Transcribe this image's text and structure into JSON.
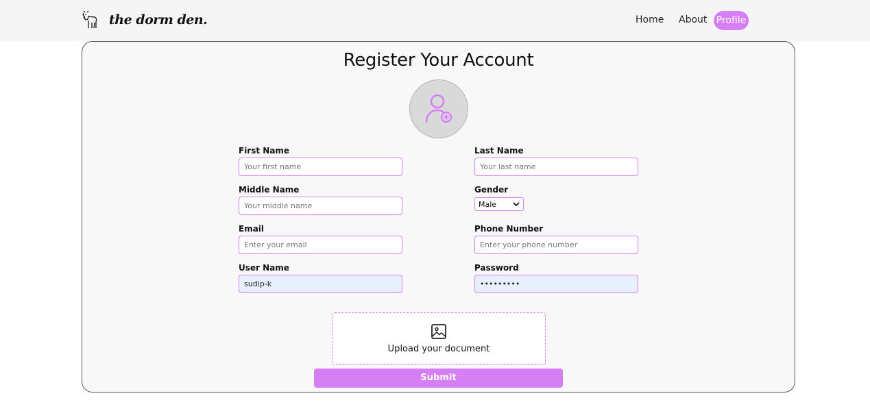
{
  "header": {
    "brand": "the dorm den.",
    "nav": {
      "home": "Home",
      "about": "About",
      "profile": "Profile"
    }
  },
  "form": {
    "title": "Register Your Account",
    "fields": {
      "first_name": {
        "label": "First Name",
        "placeholder": "Your first name",
        "value": ""
      },
      "last_name": {
        "label": "Last Name",
        "placeholder": "Your last name",
        "value": ""
      },
      "middle_name": {
        "label": "Middle Name",
        "placeholder": "Your middle name",
        "value": ""
      },
      "gender": {
        "label": "Gender",
        "selected": "Male"
      },
      "email": {
        "label": "Email",
        "placeholder": "Enter your email",
        "value": ""
      },
      "phone": {
        "label": "Phone Number",
        "placeholder": "Enter your phone number",
        "value": ""
      },
      "username": {
        "label": "User Name",
        "value": "sudip-k"
      },
      "password": {
        "label": "Password",
        "value": "•••••••••"
      }
    },
    "upload_label": "Upload your document",
    "submit_label": "Submit"
  },
  "colors": {
    "accent": "#d67ff5",
    "avatar_bg": "#d9d9d9",
    "autofill_bg": "#e8f0fe"
  },
  "icons": {
    "logo": "goat-logo-icon",
    "avatar": "add-user-icon",
    "upload": "image-icon",
    "select": "chevron-down-icon"
  }
}
